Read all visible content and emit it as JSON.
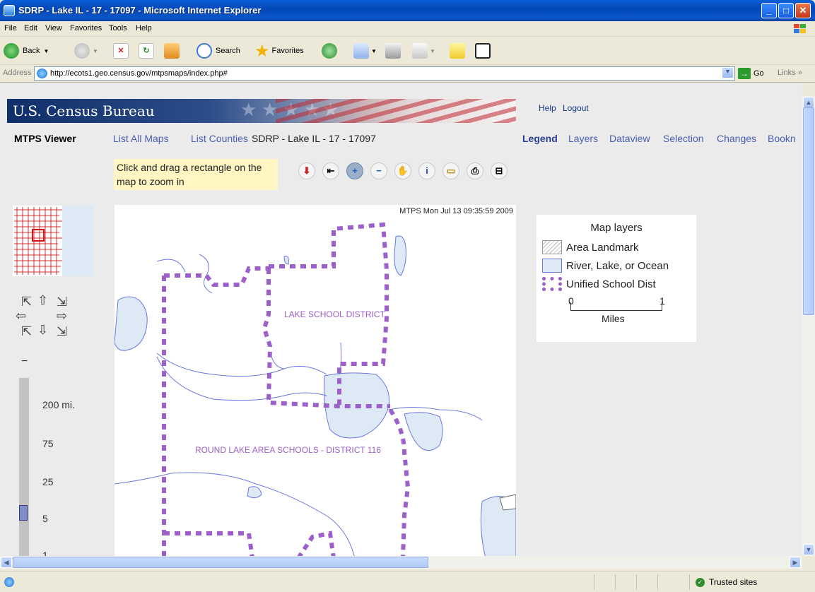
{
  "window": {
    "title": "SDRP - Lake IL - 17 - 17097 - Microsoft Internet Explorer"
  },
  "menu": [
    "File",
    "Edit",
    "View",
    "Favorites",
    "Tools",
    "Help"
  ],
  "toolbar": {
    "back": "Back",
    "search": "Search",
    "favorites": "Favorites"
  },
  "address": {
    "label": "Address",
    "url": "http://ecots1.geo.census.gov/mtpsmaps/index.php#",
    "go": "Go",
    "links": "Links"
  },
  "banner": {
    "title": "U.S. Census Bureau",
    "help": "Help",
    "logout": "Logout"
  },
  "nav": {
    "app_title": "MTPS Viewer",
    "list_all_maps": "List All Maps",
    "list_counties": "List Counties",
    "current_map": "SDRP - Lake IL - 17 - 17097",
    "tabs": [
      "Legend",
      "Layers",
      "Dataview",
      "Selection",
      "Changes",
      "Bookn"
    ]
  },
  "hint": "Click and drag a rectangle on the map to zoom in",
  "zoom_scales": [
    "200 mi.",
    "75",
    "25",
    "5",
    "1"
  ],
  "map": {
    "stamp": "MTPS Mon Jul 13 09:35:59 2009",
    "labels": {
      "lake": "LAKE SCHOOL DISTRICT",
      "round_lake": "ROUND LAKE AREA SCHOOLS - DISTRICT 116"
    }
  },
  "legend": {
    "title": "Map layers",
    "items": [
      "Area Landmark",
      "River, Lake, or Ocean",
      "Unified School Dist"
    ],
    "scale_left": "0",
    "scale_right": "1",
    "scale_unit": "Miles"
  },
  "status": {
    "zone": "Trusted sites"
  },
  "colors": {
    "boundary": "#9d5fc9",
    "water_line": "#6a78e0",
    "water_fill": "#dde9f4"
  }
}
